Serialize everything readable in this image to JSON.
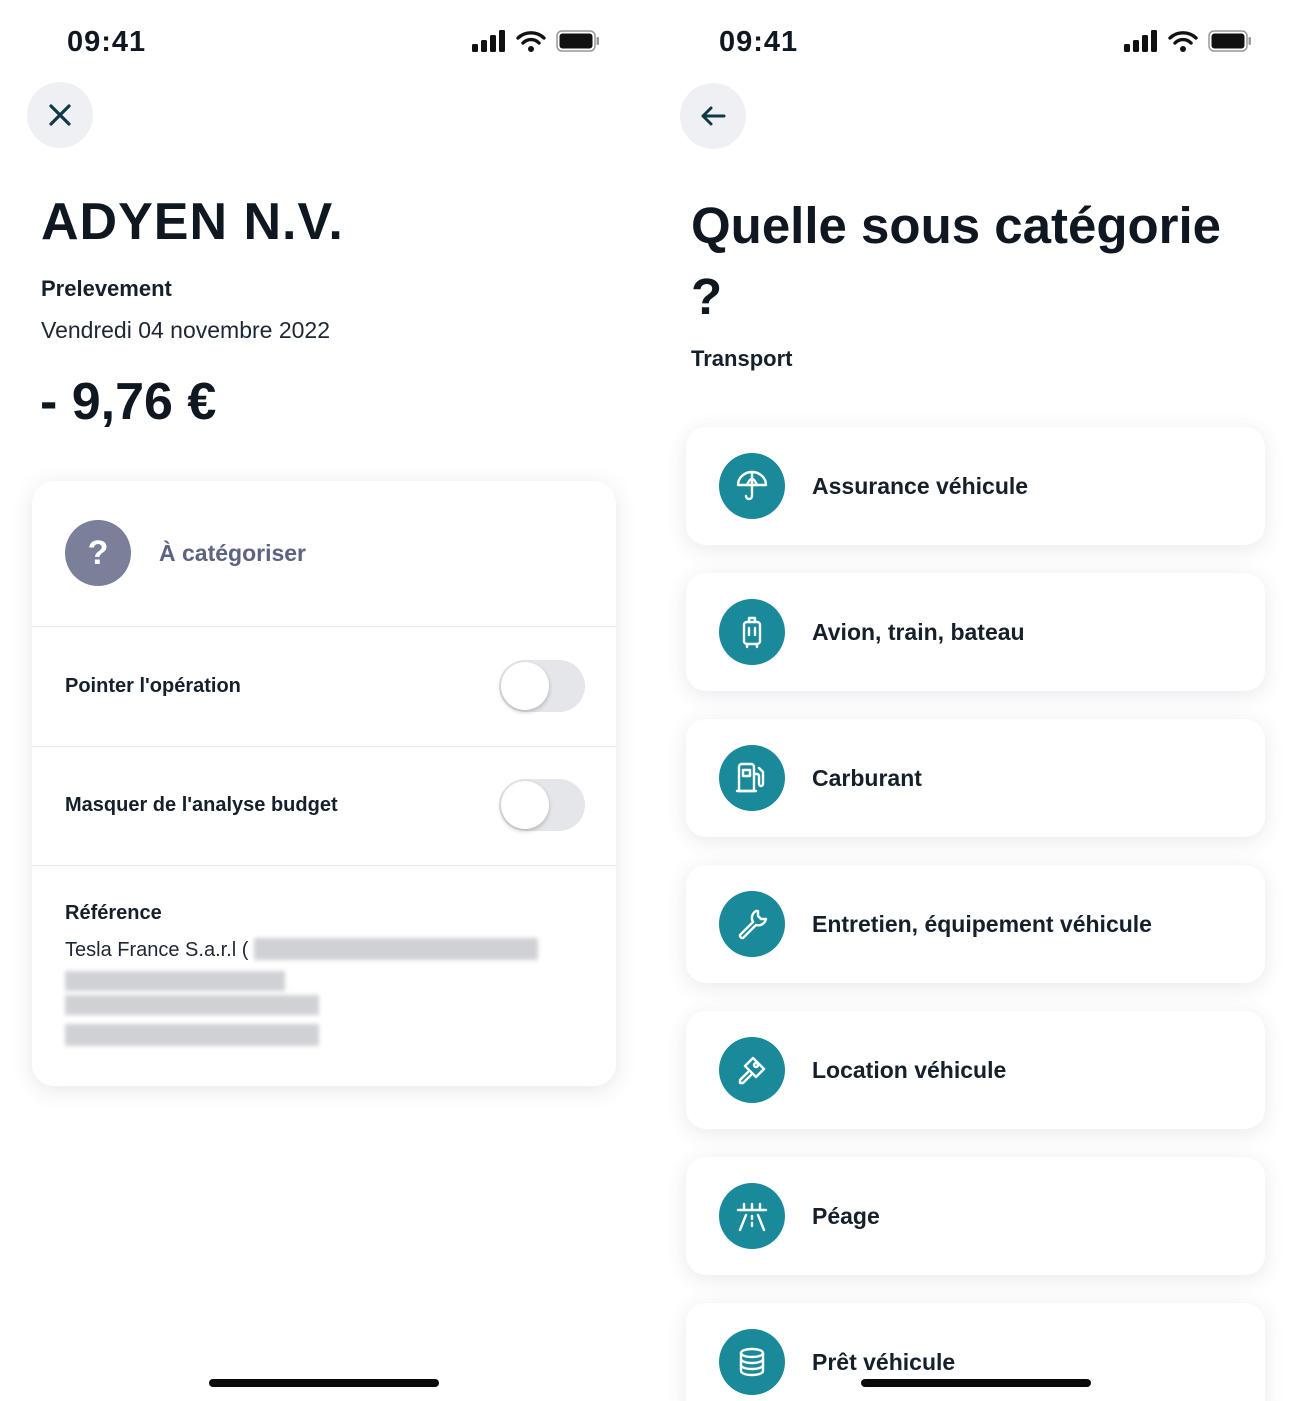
{
  "left": {
    "status_time": "09:41",
    "merchant": "ADYEN N.V.",
    "operation_type": "Prelevement",
    "date": "Vendredi 04 novembre 2022",
    "amount": "- 9,76 €",
    "category": {
      "icon": "?",
      "label": "À catégoriser"
    },
    "toggles": [
      {
        "label": "Pointer l'opération",
        "on": false
      },
      {
        "label": "Masquer de l'analyse budget",
        "on": false
      }
    ],
    "reference": {
      "title": "Référence",
      "text": "Tesla France S.a.r.l ("
    }
  },
  "right": {
    "status_time": "09:41",
    "title": "Quelle sous catégorie ?",
    "parent_category": "Transport",
    "accent_color": "#1a8a9a",
    "subcategories": [
      {
        "label": "Assurance véhicule",
        "icon": "umbrella-icon"
      },
      {
        "label": "Avion, train, bateau",
        "icon": "luggage-icon"
      },
      {
        "label": "Carburant",
        "icon": "fuel-pump-icon"
      },
      {
        "label": "Entretien, équipement véhicule",
        "icon": "wrench-icon"
      },
      {
        "label": "Location véhicule",
        "icon": "key-icon"
      },
      {
        "label": "Péage",
        "icon": "toll-road-icon"
      },
      {
        "label": "Prêt véhicule",
        "icon": "coins-icon"
      }
    ]
  }
}
